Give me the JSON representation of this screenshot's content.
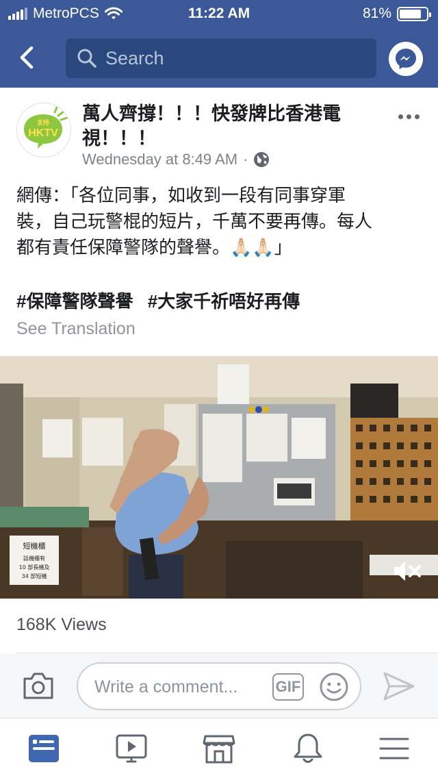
{
  "status_bar": {
    "carrier": "MetroPCS",
    "time": "11:22 AM",
    "battery_percent": "81%",
    "battery_level": 0.81,
    "icons": [
      "signal-icon",
      "wifi-icon",
      "battery-icon"
    ]
  },
  "header": {
    "search_placeholder": "Search",
    "icons": [
      "back-arrow-icon",
      "search-icon",
      "messenger-icon"
    ]
  },
  "post": {
    "page_name": "萬人齊撐！！！快發牌比香港電視！！！",
    "timestamp": "Wednesday at 8:49 AM",
    "separator": "·",
    "privacy_icon": "globe-icon",
    "body_lines": [
      "網傳：「各位同事，如收到一段有同事穿軍",
      "裝，自己玩警棍的短片，千萬不要再傳。每人",
      "都有責任保障警隊的聲譽。🙏🏻🙏🏻」"
    ],
    "hashtags": [
      "#保障警隊聲譽",
      "#大家千祈唔好再傳"
    ],
    "see_translation": "See Translation",
    "avatar_text": {
      "top": "支持",
      "bottom": "HKTV"
    },
    "video": {
      "sign_lines": [
        "短機櫃",
        "話機櫃有",
        "10 部長機及",
        "34 部短機"
      ],
      "mute_icon": "speaker-muted-icon"
    },
    "views": "168K Views"
  },
  "comment_bar": {
    "placeholder": "Write a comment...",
    "gif_label": "GIF",
    "icons": [
      "camera-icon",
      "emoji-icon",
      "send-icon"
    ]
  },
  "tabbar": {
    "tabs": [
      {
        "icon": "news-feed-icon",
        "active": true
      },
      {
        "icon": "watch-video-icon",
        "active": false
      },
      {
        "icon": "marketplace-icon",
        "active": false
      },
      {
        "icon": "notifications-bell-icon",
        "active": false
      },
      {
        "icon": "menu-icon",
        "active": false
      }
    ]
  },
  "colors": {
    "brand_blue": "#3b5998",
    "search_bg": "#29487d",
    "active_tab": "#4267b2",
    "inactive_icon": "#606770"
  }
}
